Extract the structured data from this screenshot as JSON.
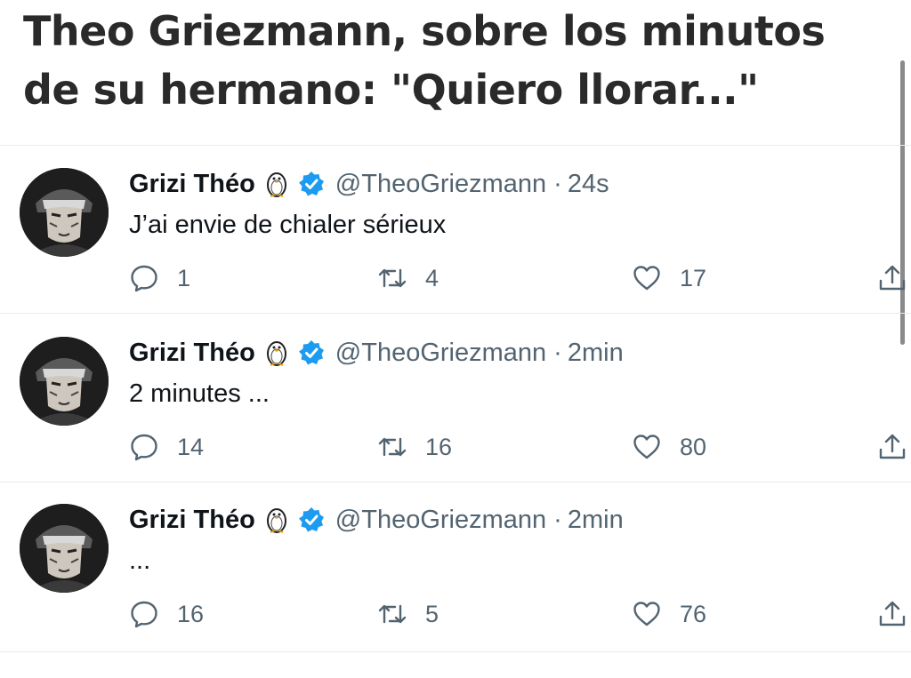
{
  "headline": {
    "line1": "Theo Griezmann, sobre los minutos",
    "line2": "de su hermano: \"Quiero llorar...\""
  },
  "tweets": [
    {
      "display_name": "Grizi Théo",
      "handle": "@TheoGriezmann",
      "separator": "·",
      "time": "24s",
      "text": "J’ai envie de chialer sérieux",
      "replies": "1",
      "retweets": "4",
      "likes": "17"
    },
    {
      "display_name": "Grizi Théo",
      "handle": "@TheoGriezmann",
      "separator": "·",
      "time": "2min",
      "text": "2 minutes ...",
      "replies": "14",
      "retweets": "16",
      "likes": "80"
    },
    {
      "display_name": "Grizi Théo",
      "handle": "@TheoGriezmann",
      "separator": "·",
      "time": "2min",
      "text": "...",
      "replies": "16",
      "retweets": "5",
      "likes": "76"
    }
  ],
  "icons": {
    "name_emoji": "penguin-icon",
    "verified": "verified-badge-icon",
    "reply": "reply-bubble-icon",
    "retweet": "retweet-icon",
    "like": "heart-icon",
    "share": "share-icon"
  },
  "colors": {
    "verified": "#1d9bf0",
    "secondary_text": "#536471",
    "divider": "#e6ecf0"
  }
}
